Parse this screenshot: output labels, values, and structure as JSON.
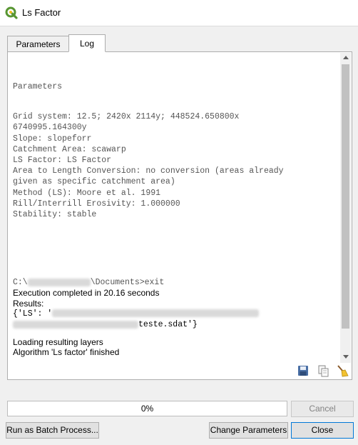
{
  "window": {
    "title": "Ls Factor",
    "icon": "qgis-icon"
  },
  "tabs": [
    {
      "label": "Parameters",
      "active": false
    },
    {
      "label": "Log",
      "active": true
    }
  ],
  "log": {
    "heading": "Parameters",
    "grid_line_1": "Grid system: 12.5; 2420x 2114y; 448524.650800x",
    "grid_line_2": "6740995.164300y",
    "slope": "Slope: slopeforr",
    "catchment": "Catchment Area: scawarp",
    "ls_factor": "LS Factor: LS Factor",
    "conversion_1": "Area to Length Conversion: no conversion (areas already",
    "conversion_2": "given as specific catchment area)",
    "method": "Method (LS): Moore et al. 1991",
    "rill": "Rill/Interrill Erosivity: 1.000000",
    "stability": "Stability: stable",
    "prompt_prefix": "C:\\",
    "prompt_suffix": "\\Documents>exit",
    "execution": "Execution completed in 20.16 seconds",
    "results_label": "Results:",
    "result_open": "{'LS': '",
    "result_file": "teste.sdat'}",
    "loading": "Loading resulting layers",
    "finished": "Algorithm 'Ls factor' finished"
  },
  "icons": {
    "save": "save-icon",
    "copy": "copy-icon",
    "clear": "clear-icon"
  },
  "progress": {
    "value": 0,
    "label": "0%"
  },
  "buttons": {
    "cancel": "Cancel",
    "batch": "Run as Batch Process...",
    "change": "Change Parameters",
    "close": "Close"
  },
  "colors": {
    "progress_fill": "#06b025",
    "default_button_border": "#0078d7"
  }
}
